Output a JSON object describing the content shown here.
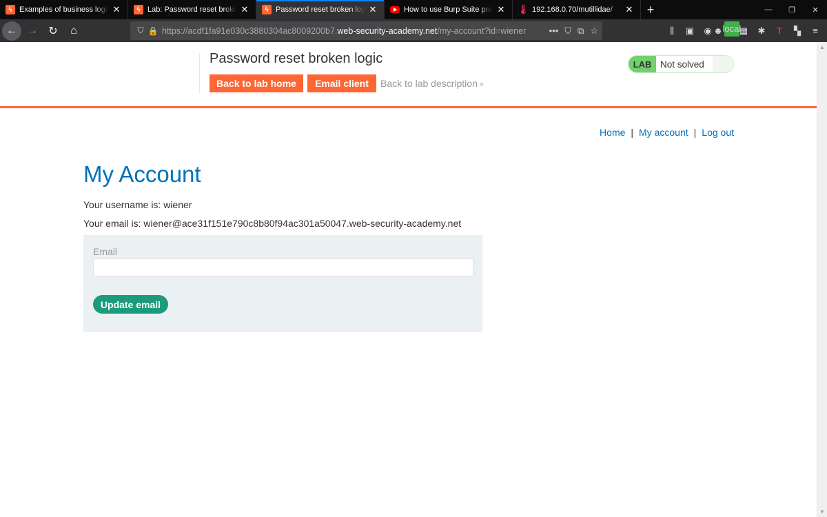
{
  "browser": {
    "tabs": [
      {
        "title": "Examples of business logic vuln",
        "favicon": "portswigger-icon",
        "active": false
      },
      {
        "title": "Lab: Password reset broken log",
        "favicon": "portswigger-icon",
        "active": false
      },
      {
        "title": "Password reset broken logic",
        "favicon": "portswigger-icon",
        "active": true
      },
      {
        "title": "How to use Burp Suite projects",
        "favicon": "youtube-icon",
        "active": false
      },
      {
        "title": "192.168.0.70/mutillidae/",
        "favicon": "thermometer-icon",
        "active": false
      }
    ],
    "url_prefix": "https://acdf1fa91e030c3880304ac8009200b7.",
    "url_host": "web-security-academy.net",
    "url_path": "/my-account?id=wiener",
    "local_badge": "local"
  },
  "lab_header": {
    "title": "Password reset broken logic",
    "back_home_label": "Back to lab home",
    "email_client_label": "Email client",
    "back_description_label": "Back to lab description",
    "status_tag": "LAB",
    "status_text": "Not solved"
  },
  "nav": {
    "home": "Home",
    "my_account": "My account",
    "log_out": "Log out",
    "separator": "|"
  },
  "account": {
    "title": "My Account",
    "username_line": "Your username is: wiener",
    "email_line": "Your email is: wiener@ace31f151e790c8b80f94ac301a50047.web-security-academy.net",
    "form": {
      "email_label": "Email",
      "email_value": "",
      "update_label": "Update email"
    }
  },
  "colors": {
    "accent": "#ff6633",
    "link": "#0071bc",
    "button_green": "#1b9b7c",
    "lab_green": "#70d16d"
  }
}
